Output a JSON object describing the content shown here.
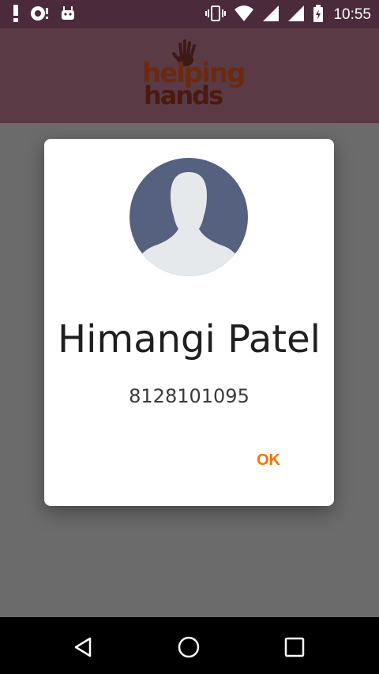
{
  "status_bar": {
    "time": "10:55",
    "icons_left": [
      "alert-icon",
      "notification-icon",
      "android-icon"
    ],
    "icons_right": [
      "vibrate-icon",
      "wifi-icon",
      "signal-icon",
      "signal-icon",
      "battery-icon"
    ]
  },
  "header": {
    "logo_text_line1": "helping",
    "logo_text_line2": "hands"
  },
  "dialog": {
    "name": "Himangi Patel",
    "phone": "8128101095",
    "ok_label": "OK"
  },
  "nav_bar": {
    "buttons": [
      "back-icon",
      "home-icon",
      "recents-icon"
    ]
  },
  "colors": {
    "status_bar": "#4a2a3b",
    "header": "#5a3a45",
    "scrim": "#6b6b6b",
    "accent": "#ff6f00",
    "avatar_bg": "#56607f"
  }
}
